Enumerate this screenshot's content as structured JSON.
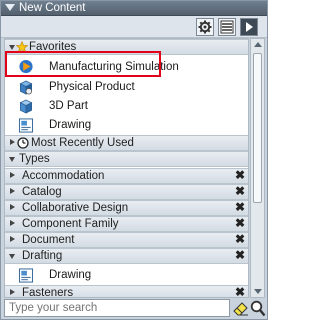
{
  "panel": {
    "title": "New Content"
  },
  "toolbar": {
    "settings_icon": "gear-icon",
    "list_icon": "list-view-icon",
    "go_icon": "arrow-right-icon"
  },
  "favorites": {
    "label": "Favorites",
    "items": [
      {
        "label": "Manufacturing Simulation",
        "icon": "manufacturing-simulation-icon"
      },
      {
        "label": "Physical Product",
        "icon": "physical-product-icon"
      },
      {
        "label": "3D Part",
        "icon": "3d-part-icon"
      },
      {
        "label": "Drawing",
        "icon": "drawing-icon"
      }
    ]
  },
  "recent": {
    "label": "Most Recently Used"
  },
  "types": {
    "label": "Types",
    "groups": [
      {
        "label": "Accommodation"
      },
      {
        "label": "Catalog"
      },
      {
        "label": "Collaborative Design"
      },
      {
        "label": "Component Family"
      },
      {
        "label": "Document"
      },
      {
        "label": "Drafting",
        "items": [
          {
            "label": "Drawing"
          }
        ]
      },
      {
        "label": "Fasteners"
      }
    ],
    "close_glyph": "✖"
  },
  "search": {
    "placeholder": "Type your search"
  },
  "colors": {
    "highlight": "#e3001b",
    "title_bg": "#5d6b79"
  }
}
